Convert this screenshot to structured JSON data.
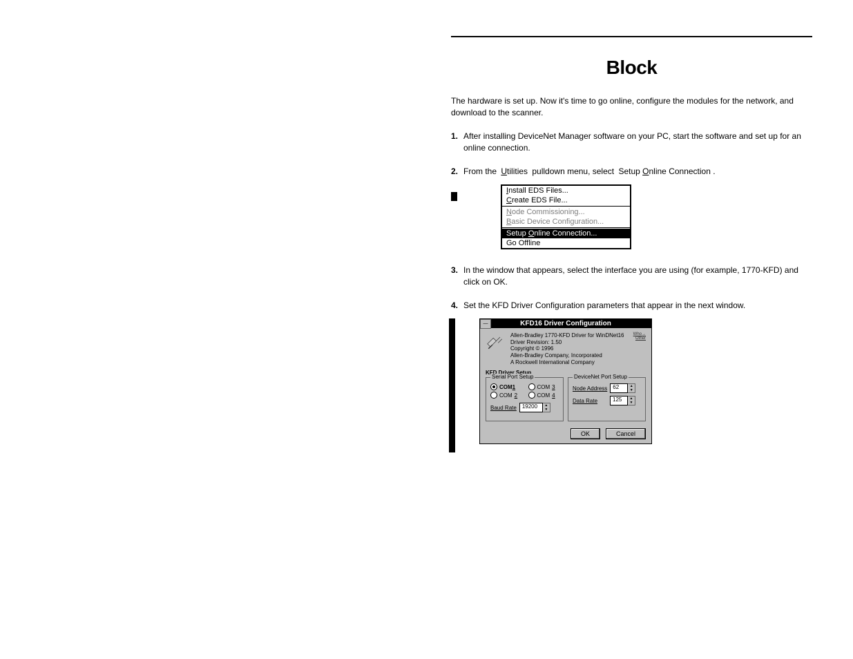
{
  "heading": "Block",
  "intro": "The hardware is set up. Now it's time to go online, configure the modules for the network, and download to the scanner.",
  "step1": {
    "num": "1.",
    "text": "After installing DeviceNet Manager software on your PC, start the software and set up for an online connection."
  },
  "step2_num": "2.",
  "step2_textA": "From the",
  "step2_textB": "pulldown menu, select",
  "menu_label_utilities": "Utilities",
  "step2_textC": ".",
  "menu": {
    "install": "Install EDS Files...",
    "create": "Create EDS File...",
    "node": "Node Commissioning...",
    "basic": "Basic Device Configuration...",
    "setup": "Setup Online Connection...",
    "go_offline": "Go Offline"
  },
  "note_after_menu": "The Setup Online Connection item is highlighted under the Utilities menu.",
  "step3": {
    "num": "3.",
    "text": "In the window that appears, select the interface you are using (for example, 1770-KFD) and click on OK."
  },
  "step4_pre": {
    "num": "4.",
    "text": "Set the KFD Driver Configuration parameters that appear in the next window."
  },
  "dlg": {
    "title": "KFD16 Driver Configuration",
    "meta_l1": "Allen-Bradley 1770-KFD Driver for WinDNet16",
    "meta_l2": "Driver Revision:  1.50",
    "meta_l3": "Copyright © 1996",
    "meta_l4": "Allen-Bradley Company, Incorporated",
    "meta_l5": "A Rockwell International Company",
    "whoami": "Who→\nOther",
    "section": "KFD Driver Setup",
    "fs1": "Serial Port Setup",
    "fs2": "DeviceNet Port Setup",
    "com1": "COM1",
    "com2": "COM2",
    "com3": "COM3",
    "com4": "COM4",
    "baud_lbl": "Baud Rate",
    "baud_val": "19200",
    "node_lbl": "Node Address",
    "node_val": "62",
    "rate_lbl": "Data Rate",
    "rate_val": "125",
    "ok": "OK",
    "cancel": "Cancel"
  }
}
